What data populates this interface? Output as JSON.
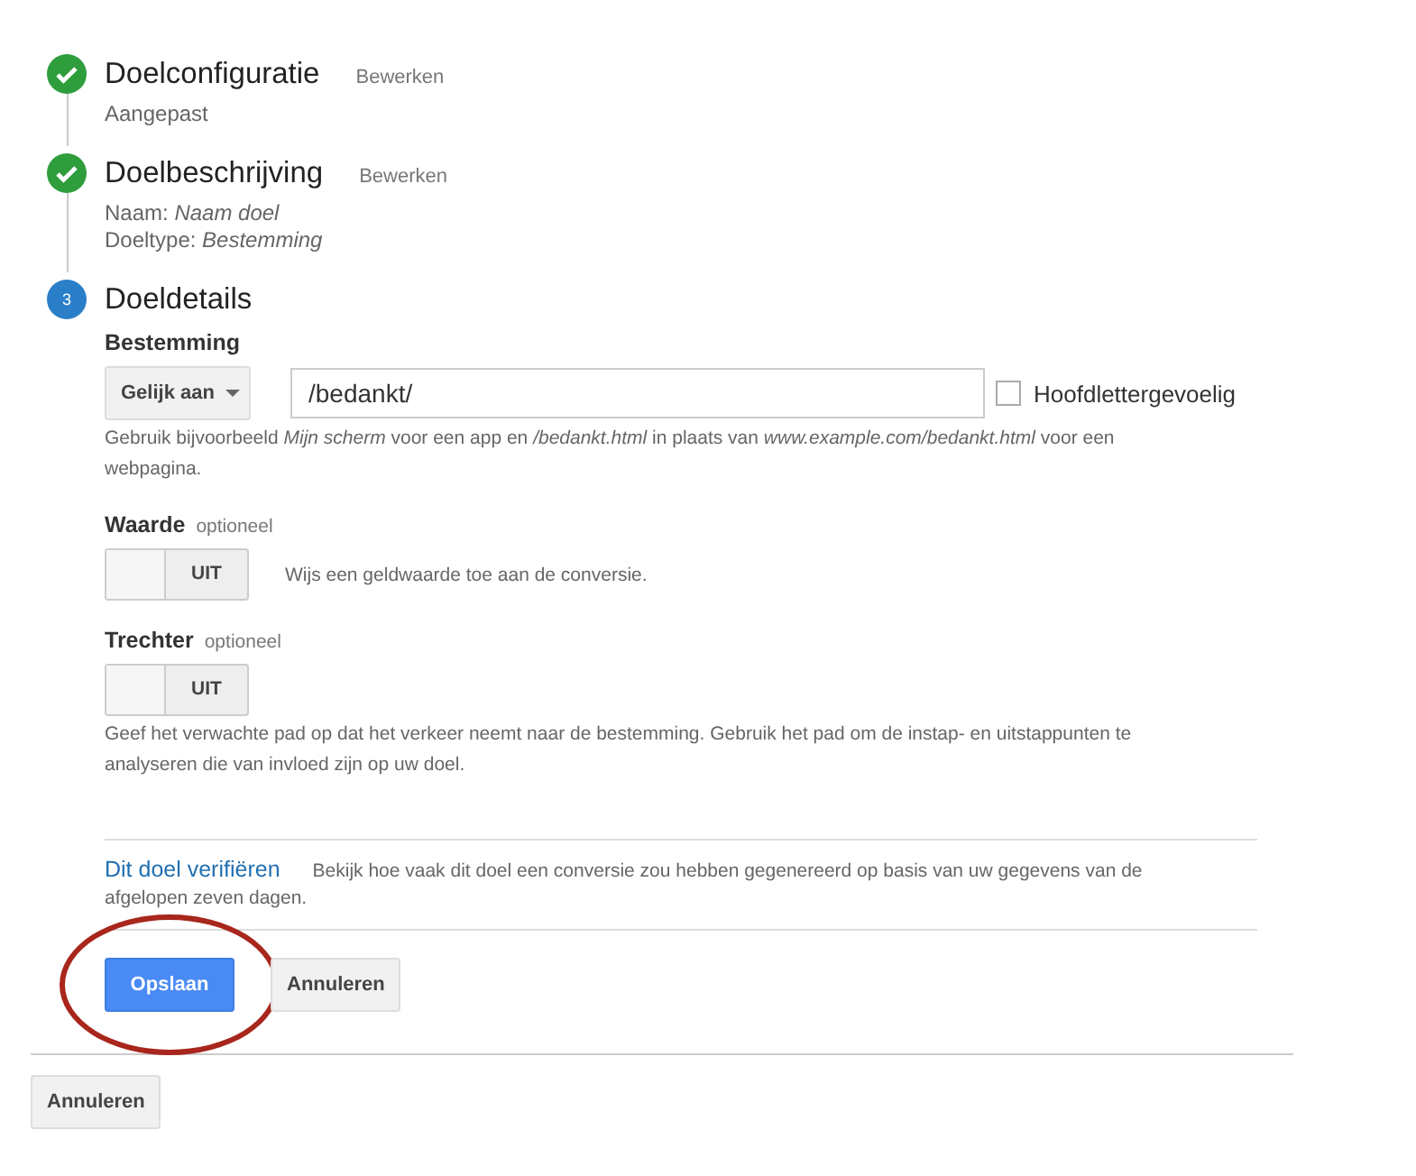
{
  "steps": [
    {
      "kind": "done",
      "title": "Doelconfiguratie",
      "edit": "Bewerken",
      "lines": [
        "Aangepast"
      ]
    },
    {
      "kind": "done",
      "title": "Doelbeschrijving",
      "edit": "Bewerken",
      "lines": [
        "Naam: *Naam doel*",
        "Doeltype: *Bestemming*"
      ]
    },
    {
      "kind": "current",
      "number": "3",
      "title": "Doeldetails"
    }
  ],
  "destination": {
    "label": "Bestemming",
    "match": "Gelijk aan",
    "value": "/bedankt/",
    "case_sensitive": {
      "label": "Hoofdlettergevoelig",
      "checked": false
    },
    "help": "Gebruik bijvoorbeeld *Mijn scherm* voor een app en */bedankt.html* in plaats van *www.example.com/bedankt.html* voor een webpagina."
  },
  "options": [
    {
      "label": "Waarde",
      "hint": "optioneel",
      "toggle": {
        "on": false,
        "text": "UIT"
      },
      "help": "Wijs een geldwaarde toe aan de conversie.",
      "kind": "inline"
    },
    {
      "label": "Trechter",
      "hint": "optioneel",
      "toggle": {
        "on": false,
        "text": "UIT"
      },
      "help": "Geef het verwachte pad op dat het verkeer neemt naar de bestemming. Gebruik het pad om de instap- en uitstappunten te analyseren die van invloed zijn op uw doel.",
      "kind": "stacked"
    }
  ],
  "verify": {
    "link": "Dit doel verifiëren",
    "text": "Bekijk hoe vaak dit doel een conversie zou hebben gegenereerd op basis van uw gegevens van de afgelopen zeven dagen."
  },
  "actions": [
    {
      "label": "Opslaan",
      "kind": "primary",
      "circled": true
    },
    {
      "label": "Annuleren",
      "kind": "secondary",
      "circled": false
    }
  ],
  "footer_button": "Annuleren"
}
